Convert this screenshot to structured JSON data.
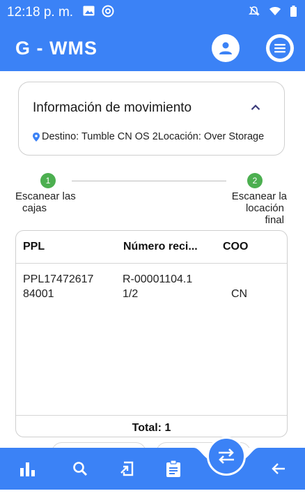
{
  "status_bar": {
    "time": "12:18 p. m.",
    "icons": [
      "image-icon",
      "at-sign-icon",
      "mute-icon",
      "wifi-icon",
      "battery-icon"
    ]
  },
  "app_bar": {
    "title": "G - WMS",
    "actions": [
      "profile-icon",
      "menu-icon"
    ]
  },
  "movement_info": {
    "title": "Información de movimiento",
    "detail": "Destino: Tumble CN OS 2Locación: Over Storage"
  },
  "stepper": {
    "steps": [
      {
        "number": "1",
        "label": "Escanear las cajas",
        "line1": "Escanear las",
        "line2": "cajas"
      },
      {
        "number": "2",
        "label": "Escanear la locación final",
        "line1": "Escanear la",
        "line2": "locación",
        "line3": "final"
      }
    ]
  },
  "table": {
    "columns": [
      "PPL",
      "Número reci...",
      "COO"
    ],
    "rows": [
      {
        "ppl": "PPL1747261784001",
        "ppl_line1": "PPL17472617",
        "ppl_line2": "84001",
        "receipt": "R-00001104.11/2",
        "receipt_line1": "R-00001104.1",
        "receipt_line2": "1/2",
        "coo": "CN"
      }
    ],
    "total_label": "Total: 1"
  },
  "bottom_nav": {
    "items": [
      "bar-chart-icon",
      "search-icon",
      "move-in-icon",
      "clipboard-icon",
      "transfer-icon",
      "back-arrow-icon"
    ],
    "active": "transfer-icon"
  },
  "colors": {
    "primary": "#3b82f6",
    "step_done": "#4caf50",
    "card_border": "#cfcfcf"
  }
}
